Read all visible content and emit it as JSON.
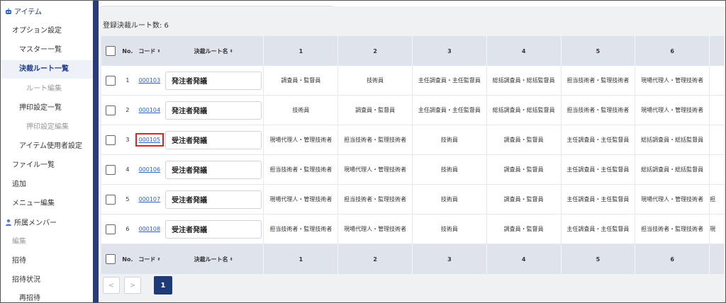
{
  "sidebar": {
    "items": [
      {
        "label": "アイテム",
        "icon": "robot-icon"
      },
      {
        "label": "オプション設定"
      },
      {
        "label": "マスター一覧"
      },
      {
        "label": "決裁ルート一覧"
      },
      {
        "label": "ルート編集"
      },
      {
        "label": "押印設定一覧"
      },
      {
        "label": "押印設定編集"
      },
      {
        "label": "アイテム使用者設定"
      },
      {
        "label": "ファイル一覧"
      },
      {
        "label": "追加"
      },
      {
        "label": "メニュー編集"
      },
      {
        "label": "所属メンバー",
        "icon": "person-icon"
      },
      {
        "label": "編集"
      },
      {
        "label": "招待"
      },
      {
        "label": "招待状況"
      },
      {
        "label": "再招待"
      }
    ]
  },
  "main": {
    "route_count": "登録決裁ルート数: 6",
    "columns": {
      "no": "No.",
      "code": "コード",
      "name": "決裁ルート名",
      "sort_symbol": "⬍",
      "steps": [
        "1",
        "2",
        "3",
        "4",
        "5",
        "6"
      ]
    },
    "rows": [
      {
        "no": "1",
        "code": "000103",
        "name": "発注者発議",
        "steps": [
          "調査員・監督員",
          "技術員",
          "主任調査員・主任監督員",
          "総括調査員・総括監督員",
          "担当技術者・監理技術者",
          "現場代理人・管理技術者"
        ],
        "extra": ""
      },
      {
        "no": "2",
        "code": "000104",
        "name": "発注者発議",
        "steps": [
          "技術員",
          "調査員・監督員",
          "主任調査員・主任監督員",
          "総括調査員・総括監督員",
          "担当技術者・監理技術者",
          "現場代理人・管理技術者"
        ],
        "extra": ""
      },
      {
        "no": "3",
        "code": "000105",
        "name": "受注者発議",
        "steps": [
          "現場代理人・管理技術者",
          "担当技術者・監理技術者",
          "技術員",
          "調査員・監督員",
          "主任調査員・主任監督員",
          "総括調査員・総括監督員"
        ],
        "extra": ""
      },
      {
        "no": "4",
        "code": "000106",
        "name": "受注者発議",
        "steps": [
          "担当技術者・監理技術者",
          "現場代理人・管理技術者",
          "技術員",
          "調査員・監督員",
          "主任調査員・主任監督員",
          "総括調査員・総括監督員"
        ],
        "extra": ""
      },
      {
        "no": "5",
        "code": "000107",
        "name": "受注者発議",
        "steps": [
          "現場代理人・管理技術者",
          "担当技術者・監理技術者",
          "技術員",
          "調査員・監督員",
          "主任調査員・主任監督員",
          "現場代理人・管理技術者"
        ],
        "extra": "担"
      },
      {
        "no": "6",
        "code": "000108",
        "name": "受注者発議",
        "steps": [
          "担当技術者・監理技術者",
          "現場代理人・管理技術者",
          "技術員",
          "調査員・監督員",
          "主任調査員・主任監督員",
          "担当技術者・監理技術者"
        ],
        "extra": "現"
      }
    ],
    "pagination": {
      "prev": "<",
      "next": ">",
      "current": "1"
    }
  },
  "colors": {
    "accent": "#1f3a78",
    "link": "#2b5fc9",
    "highlight": "#d22222"
  }
}
